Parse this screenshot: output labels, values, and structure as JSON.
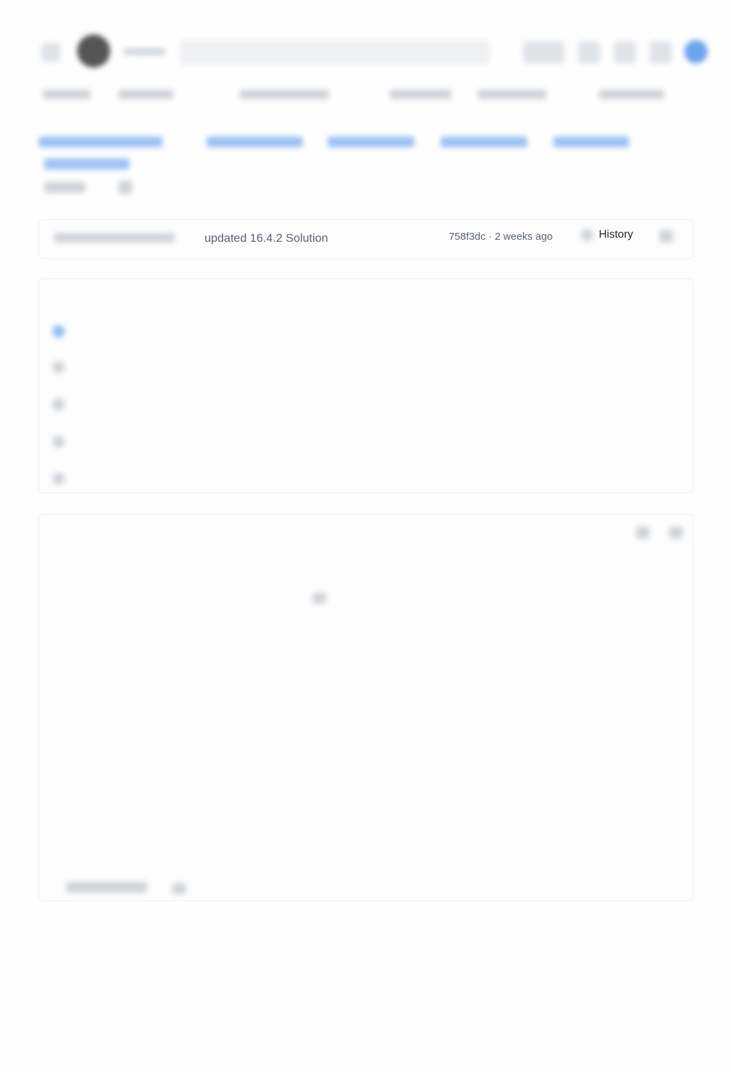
{
  "commit": {
    "message": "updated 16.4.2 Solution",
    "hash_time": "758f3dc · 2 weeks ago",
    "history_label": "History"
  },
  "colors": {
    "accent": "#0969da",
    "text_muted": "#59636e"
  },
  "icons": [
    "menu-icon",
    "github-logo-icon",
    "search-icon",
    "history-icon",
    "copy-icon",
    "edit-icon"
  ]
}
